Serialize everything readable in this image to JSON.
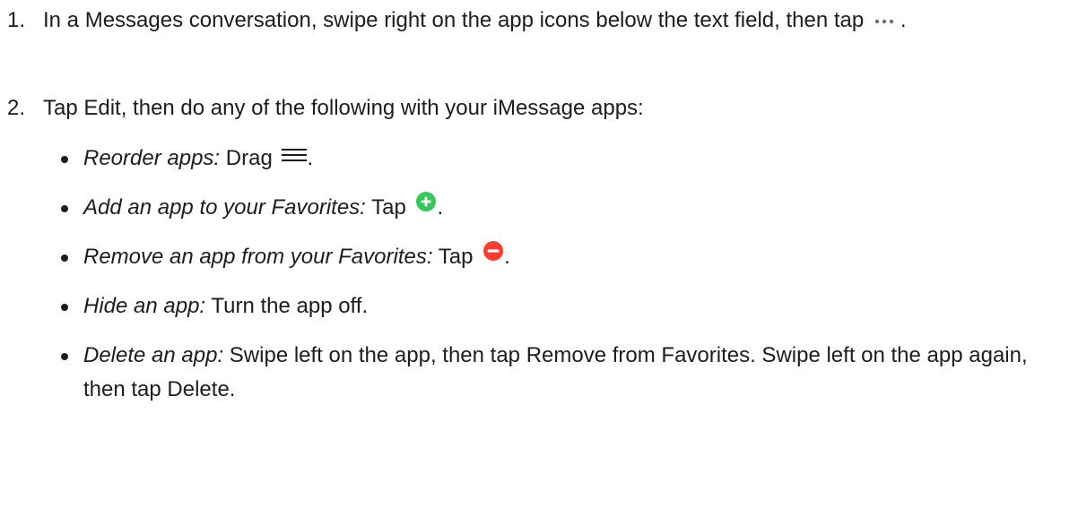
{
  "steps": [
    {
      "number": "1.",
      "text_before": "In a Messages conversation, swipe right on the app icons below the text field, then tap",
      "icon": "ellipsis-icon",
      "text_after": "."
    },
    {
      "number": "2.",
      "text": "Tap Edit, then do any of the following with your iMessage apps:",
      "bullets": [
        {
          "label": "Reorder apps:",
          "text_before": "Drag",
          "icon": "reorder-handle-icon",
          "text_after": "."
        },
        {
          "label": "Add an app to your Favorites:",
          "text_before": "Tap",
          "icon": "add-favorite-icon",
          "text_after": "."
        },
        {
          "label": "Remove an app from your Favorites:",
          "text_before": "Tap",
          "icon": "remove-favorite-icon",
          "text_after": "."
        },
        {
          "label": "Hide an app:",
          "text": "Turn the app off."
        },
        {
          "label": "Delete an app:",
          "text": "Swipe left on the app, then tap Remove from Favorites. Swipe left on the app again, then tap Delete."
        }
      ]
    }
  ],
  "colors": {
    "text": "#1d1d1f",
    "ellipsis": "#6e6e73",
    "add_green": "#34c759",
    "remove_red": "#ff3b30"
  }
}
